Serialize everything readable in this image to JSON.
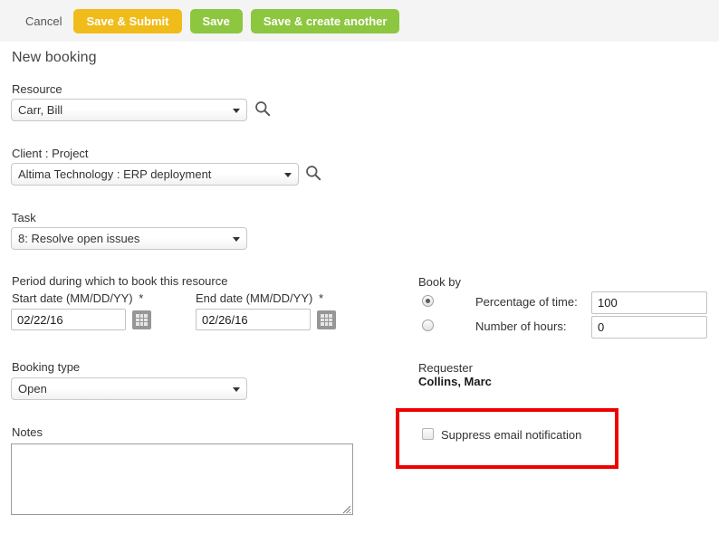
{
  "toolbar": {
    "cancel_label": "Cancel",
    "save_submit_label": "Save & Submit",
    "save_label": "Save",
    "save_create_another_label": "Save & create another",
    "amber_color": "#f0bc1b",
    "green_color": "#8dc63f",
    "background_color": "#f4f4f4"
  },
  "page": {
    "title": "New booking"
  },
  "form": {
    "resource": {
      "label": "Resource",
      "value": "Carr, Bill",
      "search_icon": "search-icon"
    },
    "client_project": {
      "label": "Client : Project",
      "value": "Altima Technology : ERP deployment",
      "search_icon": "search-icon"
    },
    "task": {
      "label": "Task",
      "value": "8: Resolve open issues"
    },
    "period": {
      "section_label": "Period during which to book this resource",
      "start_label": "Start date (MM/DD/YY)",
      "start_required": "*",
      "start_value": "02/22/16",
      "end_label": "End date (MM/DD/YY)",
      "end_required": "*",
      "end_value": "02/26/16",
      "calendar_icon": "calendar-icon"
    },
    "booking_type": {
      "label": "Booking type",
      "value": "Open"
    },
    "notes": {
      "label": "Notes",
      "value": "",
      "placeholder": ""
    }
  },
  "book_by": {
    "label": "Book by",
    "options": [
      {
        "id": "percentage",
        "label": "Percentage of time:",
        "value": "100",
        "selected": true
      },
      {
        "id": "hours",
        "label": "Number of hours:",
        "value": "0",
        "selected": false
      }
    ]
  },
  "requester": {
    "label": "Requester",
    "name": "Collins, Marc"
  },
  "suppress": {
    "checkbox_label": "Suppress email notification",
    "checked": false,
    "highlight_color": "#ee0000"
  }
}
